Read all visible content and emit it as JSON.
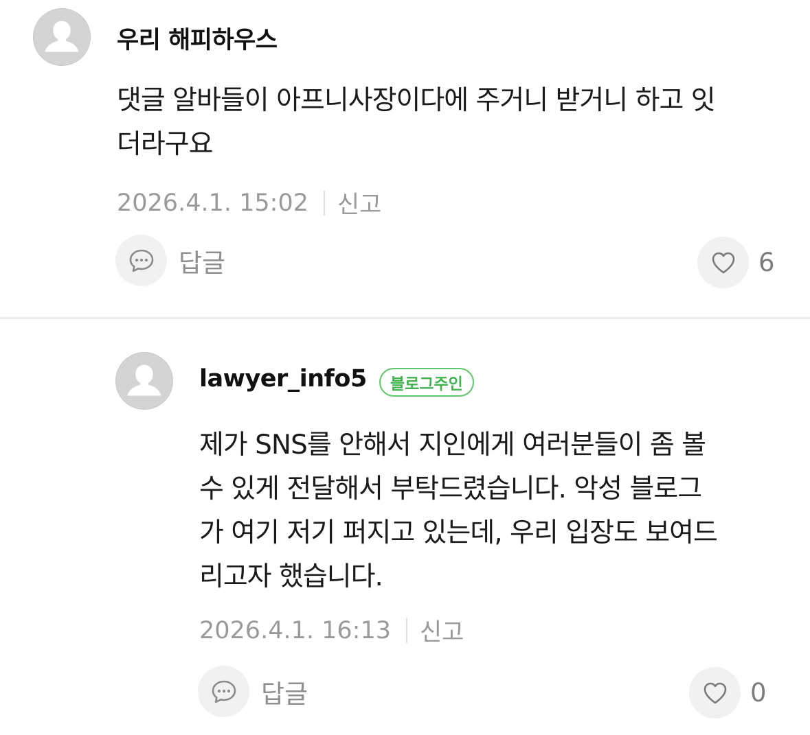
{
  "comments": [
    {
      "author": "우리 해피하우스",
      "text_line1": "댓글 알바들이 아프니사장이다에 주거니 받거니 하고 잇",
      "text_line2": "더라구요",
      "datetime": "2026.4.1. 15:02",
      "report_label": "신고",
      "reply_label": "답글",
      "like_count": "6"
    },
    {
      "author": "lawyer_info5",
      "badge": "블로그주인",
      "text_line1": "제가 SNS를 안해서 지인에게 여러분들이 좀 볼",
      "text_line2": "수 있게 전달해서 부탁드렸습니다. 악성 블로그",
      "text_line3": "가 여기 저기 퍼지고 있는데, 우리 입장도 보여드",
      "text_line4": "리고자 했습니다.",
      "datetime": "2026.4.1. 16:13",
      "report_label": "신고",
      "reply_label": "답글",
      "like_count": "0"
    }
  ],
  "icons": {
    "avatar": "default-user-avatar-icon",
    "reply": "speech-bubble-icon",
    "like": "heart-outline-icon"
  },
  "colors": {
    "badge_green": "#41b24f",
    "meta_gray": "#9a9a9a",
    "button_bg": "#f1f1f1"
  }
}
